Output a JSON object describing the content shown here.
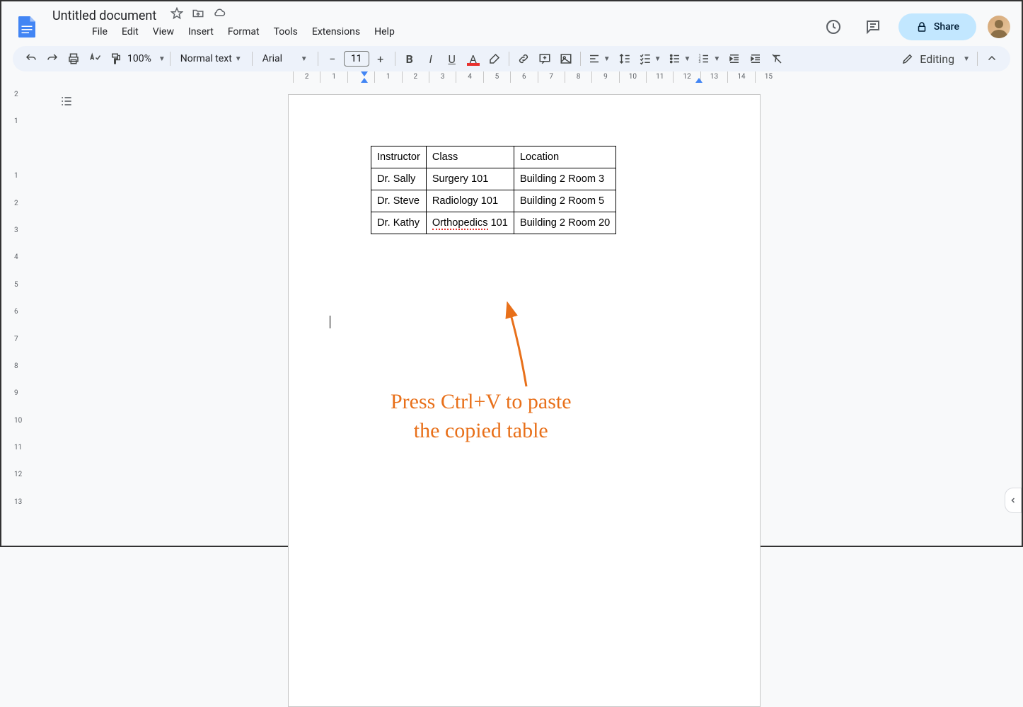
{
  "doc": {
    "title": "Untitled document"
  },
  "menubar": [
    "File",
    "Edit",
    "View",
    "Insert",
    "Format",
    "Tools",
    "Extensions",
    "Help"
  ],
  "toolbar": {
    "zoom": "100%",
    "style": "Normal text",
    "font": "Arial",
    "font_size": "11",
    "editing": "Editing"
  },
  "share": {
    "label": "Share"
  },
  "table": {
    "headers": [
      "Instructor",
      "Class",
      "Location"
    ],
    "rows": [
      [
        "Dr. Sally",
        "Surgery 101",
        "Building 2 Room 3"
      ],
      [
        "Dr. Steve",
        "Radiology 101",
        "Building 2 Room 5"
      ],
      [
        "Dr. Kathy",
        "Orthopedics 101",
        "Building 2 Room 20"
      ]
    ]
  },
  "annotation": {
    "line1": "Press Ctrl+V to paste",
    "line2": "the copied table"
  },
  "ruler_h_labels": [
    "2",
    "1",
    "",
    "1",
    "2",
    "3",
    "4",
    "5",
    "6",
    "7",
    "8",
    "9",
    "10",
    "11",
    "12",
    "13",
    "14",
    "15"
  ],
  "ruler_v_labels": [
    "2",
    "1",
    "",
    "1",
    "2",
    "3",
    "4",
    "5",
    "6",
    "7",
    "8",
    "9",
    "10",
    "11",
    "12",
    "13"
  ]
}
